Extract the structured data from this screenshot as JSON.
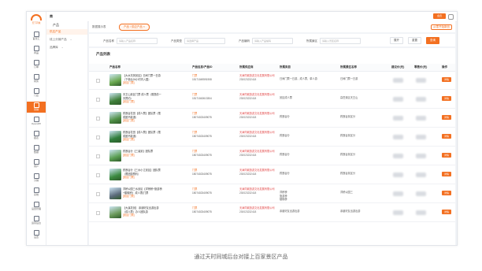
{
  "brand": {
    "name": "天下同城",
    "accent": "#f37021"
  },
  "nav": [
    {
      "label": "首页汇"
    },
    {
      "label": "商品"
    },
    {
      "label": "订单"
    },
    {
      "label": "财务"
    },
    {
      "label": "门店"
    },
    {
      "label": "营销"
    },
    {
      "label": "OpenAPI"
    },
    {
      "label": "报表"
    },
    {
      "label": "数据"
    },
    {
      "label": "用户"
    },
    {
      "label": "分销"
    },
    {
      "label": "系统"
    },
    {
      "label": "设置管理"
    },
    {
      "label": "运营后台"
    },
    {
      "label": "设置"
    }
  ],
  "active_nav_index": 5,
  "topbar": {
    "crumb": "商",
    "user": "会员"
  },
  "subnav": {
    "title": "产品",
    "items": [
      {
        "label": "供应产品",
        "active": true
      },
      {
        "label": "线上分销产品",
        "arrow": "⌄"
      },
      {
        "label": "品牌库",
        "arrow": "⌄"
      }
    ]
  },
  "tabs": {
    "label": "数据展示表",
    "active_tab": "产品 / 供应产品 ×",
    "right_action": "从零开始新品"
  },
  "filters": {
    "product_name": {
      "label": "产品名称",
      "placeholder": "请输入产品名称"
    },
    "product_type": {
      "label": "产品类型",
      "placeholder": "请选择产品"
    },
    "product_code": {
      "label": "产品编码",
      "placeholder": "请输入产品编码"
    },
    "scenic_name": {
      "label": "所属景区",
      "placeholder": "请输入景区名称"
    },
    "buttons": {
      "expand": "展开",
      "reset": "重置",
      "query": "查询"
    }
  },
  "list": {
    "title": "产品列表",
    "columns": [
      "产品名称",
      "产品信息/产品ID",
      "所属供应商",
      "所属类目",
      "所属景区名称",
      "建议价(元)",
      "零售价(元)",
      "操作"
    ]
  },
  "rows": [
    {
      "thumb": "#6aa84f",
      "name": "【大水坑风景区】日间门票一日游（下单后24小时内入园）",
      "tag": "[景区门票]",
      "status": "门票",
      "id": "15171049591908",
      "supplier": "天津同城旅游文化发展有限公司",
      "sup_code": "230023232418",
      "category": "日间门票一日游，成人票，单人游",
      "scenic": "日间门票一日游",
      "op": "详情"
    },
    {
      "thumb": "#3f7f3a",
      "name": "天王山景区门票 成人票（需提前一天预约）",
      "tag": "[景区门票]",
      "status": "门票",
      "id": "15171043613304",
      "supplier": "天津同城旅游文化发展有限公司",
      "sup_code": "230023232418",
      "category": "景区成人票",
      "scenic": "高岳景区天王山",
      "op": "详情"
    },
    {
      "thumb": "#4f8f46",
      "name": "药莲谷花田【成人票】团队票（限成团不能退）",
      "tag": "[景区门票]",
      "status": "门票",
      "id": "15074023409075",
      "supplier": "天津同城旅游文化发展有限公司",
      "sup_code": "230023232418",
      "category": "药莲谷分",
      "scenic": "药莲谷景区分",
      "op": "详情"
    },
    {
      "thumb": "#2f7d3c",
      "name": "药莲谷花田【成人票】团队票（限成团不能退）",
      "tag": "[景区门票]",
      "status": "门票",
      "id": "15074023409075",
      "supplier": "天津同城旅游文化发展有限公司",
      "sup_code": "230023232418",
      "category": "药莲谷分",
      "scenic": "药莲谷景区分",
      "op": "详情"
    },
    {
      "thumb": "#5a9e52",
      "name": "药莲谷分【三溪景】团队票",
      "tag": "[景区门票]",
      "status": "门票",
      "id": "15074023409075",
      "supplier": "天津同城旅游文化发展有限公司",
      "sup_code": "230023232418",
      "category": "药莲谷分",
      "scenic": "药莲谷景区分",
      "op": "详情"
    },
    {
      "thumb": "#3b8a40",
      "name": "药莲谷分【三水小江景区】团队票（限团游预约）",
      "tag": "[景区门票]",
      "status": "门票",
      "id": "15074023409075",
      "supplier": "天津同城旅游文化发展有限公司",
      "sup_code": "230023232418",
      "category": "药莲谷分",
      "scenic": "药莲谷景区分",
      "op": "详情"
    },
    {
      "thumb": "#5b6b7b",
      "name": "洋桥公园三水景区【洋桥桥+旅游桥+楼梯桥】 成人票|门票",
      "tag": "[景区门票]",
      "status": "门票",
      "id": "15074023409075",
      "supplier": "天津同城旅游文化发展有限公司",
      "sup_code": "230023232418",
      "category": "洋桥桥\n旅游桥\n楼梯桥",
      "scenic": "洋桥公园三",
      "op": "详情"
    },
    {
      "thumb": "#6b9a5a",
      "name": "【大溪花景】 亲朋好友出游出游（成人票）办人团队游",
      "tag": "[景区门票]",
      "status": "门票",
      "id": "15074023409075",
      "supplier": "天津同城旅游文化发展有限公司",
      "sup_code": "230023232418",
      "category": "亲朋好友出游出游",
      "scenic": "亲朋好友出游出游",
      "op": "详情"
    }
  ],
  "caption": "通过天时同城后台对接上百家景区产品"
}
